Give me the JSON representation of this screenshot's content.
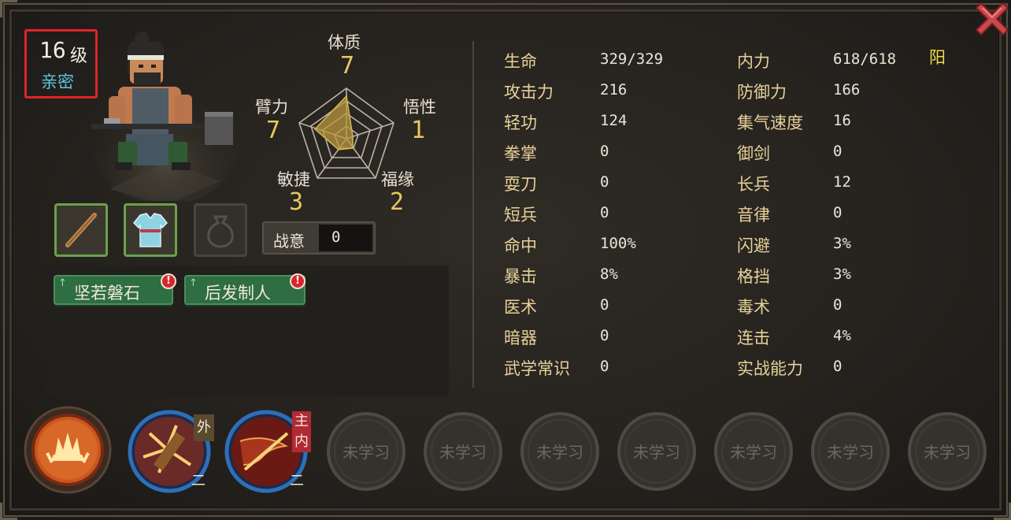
{
  "character": {
    "level": "16",
    "level_unit": "级",
    "relation": "亲密"
  },
  "attributes": [
    {
      "name": "体质",
      "value": "7"
    },
    {
      "name": "悟性",
      "value": "1"
    },
    {
      "name": "福缘",
      "value": "2"
    },
    {
      "name": "敏捷",
      "value": "3"
    },
    {
      "name": "臂力",
      "value": "7"
    }
  ],
  "zhanyi": {
    "label": "战意",
    "value": "0"
  },
  "equipment": [
    {
      "slot": "weapon",
      "icon": "staff-icon",
      "equipped": true
    },
    {
      "slot": "armor",
      "icon": "robe-icon",
      "equipped": true
    },
    {
      "slot": "accessory",
      "icon": "pouch-icon",
      "equipped": false
    }
  ],
  "traits": [
    {
      "label": "坚若磐石",
      "alert": "!"
    },
    {
      "label": "后发制人",
      "alert": "!"
    }
  ],
  "stats_left": [
    {
      "label": "生命",
      "value": "329/329"
    },
    {
      "label": "攻击力",
      "value": "216"
    },
    {
      "label": "轻功",
      "value": "124"
    },
    {
      "label": "拳掌",
      "value": "0"
    },
    {
      "label": "耍刀",
      "value": "0"
    },
    {
      "label": "短兵",
      "value": "0"
    },
    {
      "label": "命中",
      "value": "100%"
    },
    {
      "label": "暴击",
      "value": "8%"
    },
    {
      "label": "医术",
      "value": "0"
    },
    {
      "label": "暗器",
      "value": "0"
    },
    {
      "label": "武学常识",
      "value": "0"
    }
  ],
  "stats_right": [
    {
      "label": "内力",
      "value": "618/618"
    },
    {
      "label": "防御力",
      "value": "166"
    },
    {
      "label": "集气速度",
      "value": "16"
    },
    {
      "label": "御剑",
      "value": "0"
    },
    {
      "label": "长兵",
      "value": "12"
    },
    {
      "label": "音律",
      "value": "0"
    },
    {
      "label": "闪避",
      "value": "3%"
    },
    {
      "label": "格挡",
      "value": "3%"
    },
    {
      "label": "毒术",
      "value": "0"
    },
    {
      "label": "连击",
      "value": "4%"
    },
    {
      "label": "实战能力",
      "value": "0"
    }
  ],
  "yang_label": "阳",
  "skills": {
    "slot1": {
      "icon": "flame-palm-icon"
    },
    "slot2": {
      "icon": "shattering-strike-icon",
      "badge": "外",
      "rank": "二"
    },
    "slot3": {
      "icon": "dragon-blade-icon",
      "badge_main": "主",
      "badge_inner": "内",
      "rank": "二"
    },
    "locked_label": "未学习",
    "locked_count": 7
  },
  "colors": {
    "accent_gold": "#e8c860",
    "stat_label": "#e7d19a",
    "relation": "#5ec7e0",
    "highlight_red": "#e0242a",
    "tag_green": "#2f6d42"
  }
}
